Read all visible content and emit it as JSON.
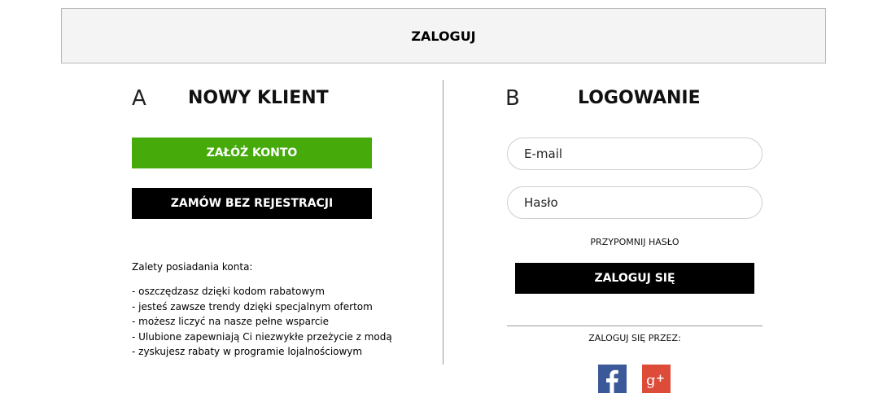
{
  "header": {
    "title": "ZALOGUJ"
  },
  "new_client": {
    "letter": "A",
    "title": "NOWY KLIENT",
    "create_account_label": "ZAŁÓŻ KONTO",
    "order_without_registration_label": "ZAMÓW BEZ REJESTRACJI",
    "benefits_title": "Zalety posiadania konta:",
    "benefits": [
      "- oszczędzasz dzięki kodom rabatowym",
      "- jesteś zawsze trendy dzięki specjalnym ofertom",
      "- możesz liczyć na nasze pełne wsparcie",
      "- Ulubione zapewniają Ci niezwykłe przeżycie z modą",
      "- zyskujesz rabaty w programie lojalnościowym"
    ]
  },
  "login": {
    "letter": "B",
    "title": "LOGOWANIE",
    "email_placeholder": "E-mail",
    "password_placeholder": "Hasło",
    "forgot_password_label": "PRZYPOMNIJ HASŁO",
    "submit_label": "ZALOGUJ SIĘ",
    "social_label": "ZALOGUJ SIĘ PRZEZ:",
    "social": [
      {
        "name": "facebook",
        "icon": "facebook-icon",
        "color": "#3b5998"
      },
      {
        "name": "google-plus",
        "icon": "google-plus-icon",
        "color": "#dd4b39"
      }
    ]
  },
  "colors": {
    "green_button": "#45aa0a",
    "black_button": "#000000",
    "header_bg": "#f4f4f4"
  }
}
